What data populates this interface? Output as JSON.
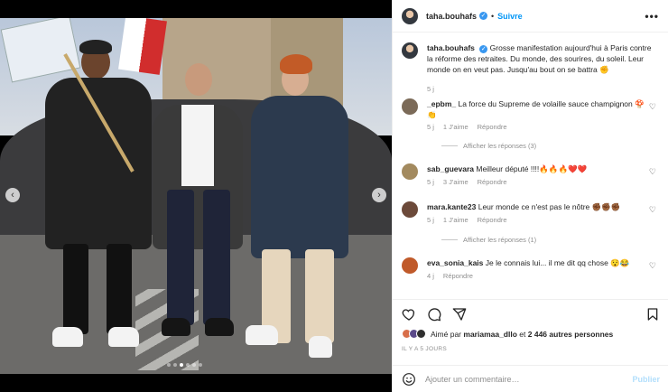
{
  "post": {
    "username": "taha.bouhafs",
    "follow_label": "Suivre",
    "more_label": "•••",
    "verified_glyph": "✓",
    "verified_icon": "verified-badge-icon",
    "caption": "Grosse manifestation aujourd'hui à Paris contre la réforme des retraites. Du monde, des sourires, du soleil. Leur monde on en veut pas. Jusqu'au bout on se battra ✊",
    "caption_time": "5 j",
    "carousel": {
      "dot_count": 6,
      "active_index": 2,
      "prev_glyph": "‹",
      "next_glyph": "›"
    }
  },
  "comments": [
    {
      "username": "_epbm_",
      "text": "La force du Supreme de volaille sauce champignon 🍄👏",
      "time": "5 j",
      "likes": "1 J'aime",
      "reply_label": "Répondre",
      "view_replies": "Afficher les réponses (3)",
      "avatar_color": "#7b6a58"
    },
    {
      "username": "sab_guevara",
      "text": "Meilleur député !!!!🔥🔥🔥❤️❤️",
      "time": "5 j",
      "likes": "3 J'aime",
      "reply_label": "Répondre",
      "avatar_color": "#a38a5f"
    },
    {
      "username": "mara.kante23",
      "text": "Leur monde ce n'est pas le nôtre ✊🏾✊🏾✊🏾",
      "time": "5 j",
      "likes": "1 J'aime",
      "reply_label": "Répondre",
      "view_replies": "Afficher les réponses (1)",
      "avatar_color": "#6c4a3a"
    },
    {
      "username": "eva_sonia_kais",
      "text": "Je le connais lui... il me dit qq chose 😯😂",
      "time": "4 j",
      "reply_label": "Répondre",
      "avatar_color": "#c05a2a"
    }
  ],
  "actions": {
    "like_icon": "heart-icon",
    "comment_icon": "comment-icon",
    "share_icon": "send-icon",
    "save_icon": "bookmark-icon",
    "heart_glyph": "♡"
  },
  "likes": {
    "prefix": "Aimé par",
    "first_user": "mariamaa_dllo",
    "connector": "et",
    "others": "2 446 autres personnes",
    "avatar_colors": [
      "#d86f4a",
      "#5b4a8a",
      "#2f2f2f"
    ]
  },
  "date_label": "IL Y A 5 JOURS",
  "add_comment": {
    "emoji_icon": "smiley-icon",
    "placeholder": "Ajouter un commentaire…",
    "publish_label": "Publier"
  }
}
